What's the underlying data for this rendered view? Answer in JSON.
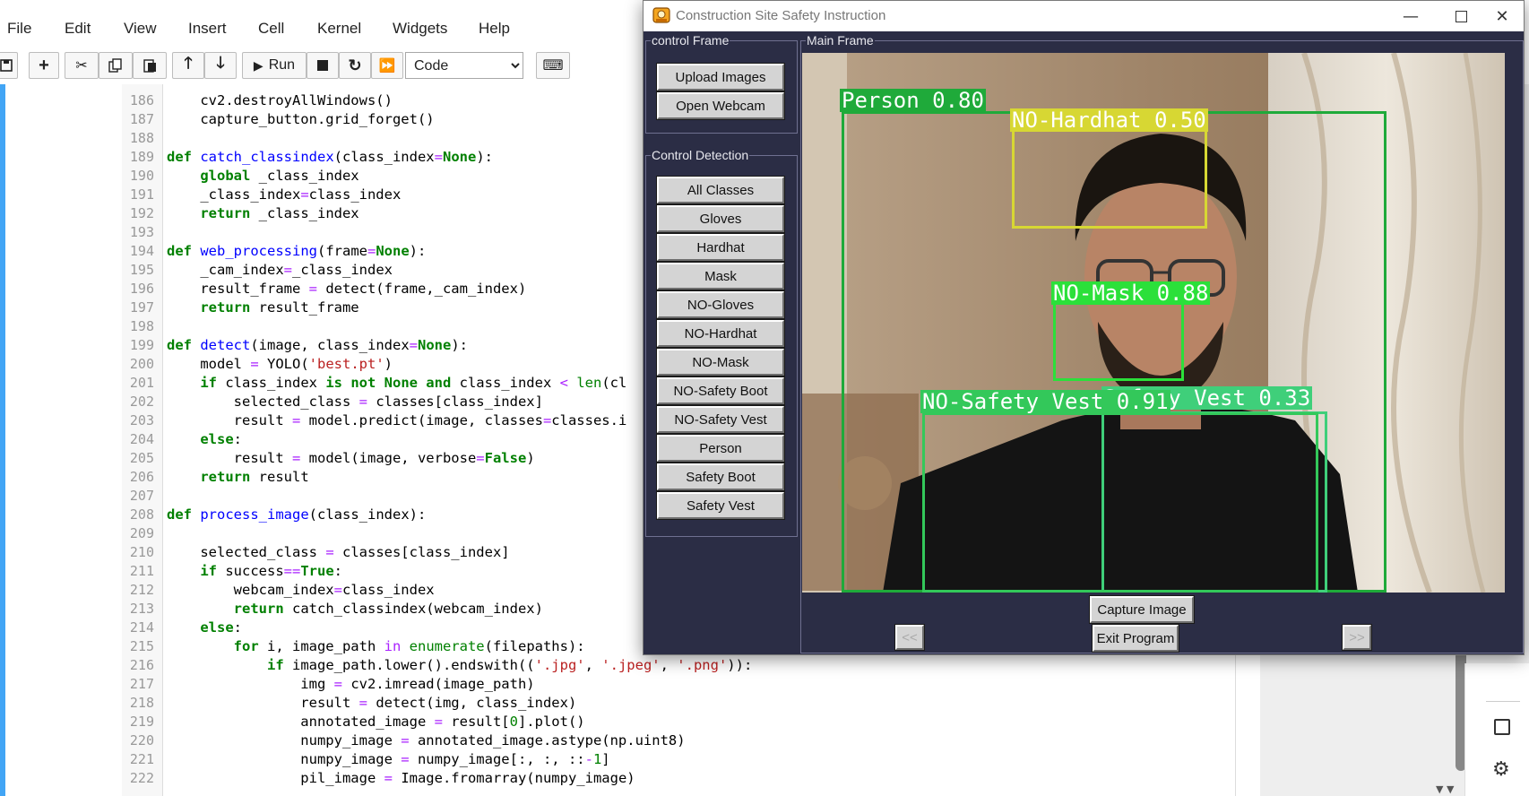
{
  "jupyter": {
    "menu": [
      "File",
      "Edit",
      "View",
      "Insert",
      "Cell",
      "Kernel",
      "Widgets",
      "Help"
    ],
    "toolbar": {
      "run_label": "Run",
      "cell_type": "Code",
      "cell_type_options": [
        "Code"
      ]
    },
    "code_lines": [
      {
        "n": "186",
        "html": "    cv2.destroyAllWindows()"
      },
      {
        "n": "187",
        "html": "    capture_button.grid_forget()"
      },
      {
        "n": "188",
        "html": ""
      },
      {
        "n": "189",
        "html": "<span class='kw'>def</span> <span class='fn'>catch_classindex</span>(class_index<span class='op'>=</span><span class='kw'>None</span>):"
      },
      {
        "n": "190",
        "html": "    <span class='kw'>global</span> _class_index"
      },
      {
        "n": "191",
        "html": "    _class_index<span class='op'>=</span>class_index"
      },
      {
        "n": "192",
        "html": "    <span class='kw'>return</span> _class_index"
      },
      {
        "n": "193",
        "html": ""
      },
      {
        "n": "194",
        "html": "<span class='kw'>def</span> <span class='fn'>web_processing</span>(frame<span class='op'>=</span><span class='kw'>None</span>):"
      },
      {
        "n": "195",
        "html": "    _cam_index<span class='op'>=</span>_class_index"
      },
      {
        "n": "196",
        "html": "    result_frame <span class='op'>=</span> detect(frame,_cam_index)"
      },
      {
        "n": "197",
        "html": "    <span class='kw'>return</span> result_frame"
      },
      {
        "n": "198",
        "html": ""
      },
      {
        "n": "199",
        "html": "<span class='kw'>def</span> <span class='fn'>detect</span>(image, class_index<span class='op'>=</span><span class='kw'>None</span>):"
      },
      {
        "n": "200",
        "html": "    model <span class='op'>=</span> YOLO(<span class='st'>'best.pt'</span>)"
      },
      {
        "n": "201",
        "html": "    <span class='kw'>if</span> class_index <span class='kw'>is not None and</span> class_index <span class='op'>&lt;</span> <span class='nb'>len</span>(cl"
      },
      {
        "n": "202",
        "html": "        selected_class <span class='op'>=</span> classes[class_index]"
      },
      {
        "n": "203",
        "html": "        result <span class='op'>=</span> model.predict(image, classes<span class='op'>=</span>classes.i"
      },
      {
        "n": "204",
        "html": "    <span class='kw'>else</span>:"
      },
      {
        "n": "205",
        "html": "        result <span class='op'>=</span> model(image, verbose<span class='op'>=</span><span class='kw'>False</span>)"
      },
      {
        "n": "206",
        "html": "    <span class='kw'>return</span> result"
      },
      {
        "n": "207",
        "html": ""
      },
      {
        "n": "208",
        "html": "<span class='kw'>def</span> <span class='fn'>process_image</span>(class_index):"
      },
      {
        "n": "209",
        "html": ""
      },
      {
        "n": "210",
        "html": "    selected_class <span class='op'>=</span> classes[class_index]"
      },
      {
        "n": "211",
        "html": "    <span class='kw'>if</span> success<span class='op'>==</span><span class='kw'>True</span>:"
      },
      {
        "n": "212",
        "html": "        webcam_index<span class='op'>=</span>class_index"
      },
      {
        "n": "213",
        "html": "        <span class='kw'>return</span> catch_classindex(webcam_index)"
      },
      {
        "n": "214",
        "html": "    <span class='kw'>else</span>:"
      },
      {
        "n": "215",
        "html": "        <span class='kw'>for</span> i, image_path <span class='op'>in</span> <span class='nb'>enumerate</span>(filepaths):"
      },
      {
        "n": "216",
        "html": "            <span class='kw'>if</span> image_path.lower().endswith((<span class='st'>'.jpg'</span>, <span class='st'>'.jpeg'</span>, <span class='st'>'.png'</span>)):"
      },
      {
        "n": "217",
        "html": "                img <span class='op'>=</span> cv2.imread(image_path)"
      },
      {
        "n": "218",
        "html": "                result <span class='op'>=</span> detect(img, class_index)"
      },
      {
        "n": "219",
        "html": "                annotated_image <span class='op'>=</span> result[<span class='nm'>0</span>].plot()"
      },
      {
        "n": "220",
        "html": "                numpy_image <span class='op'>=</span> annotated_image.astype(np.uint8)"
      },
      {
        "n": "221",
        "html": "                numpy_image <span class='op'>=</span> numpy_image[:, :, ::<span class='op'>-</span><span class='nm'>1</span>]"
      },
      {
        "n": "222",
        "html": "                pil_image <span class='op'>=</span> Image.fromarray(numpy_image)"
      }
    ]
  },
  "app": {
    "title": "Construction Site Safety Instruction",
    "control_frame_label": "control Frame",
    "upload_images": "Upload Images",
    "open_webcam": "Open Webcam",
    "control_detection_label": "Control Detection",
    "class_buttons": [
      "All Classes",
      "Gloves",
      "Hardhat",
      "Mask",
      "NO-Gloves",
      "NO-Hardhat",
      "NO-Mask",
      "NO-Safety Boot",
      "NO-Safety Vest",
      "Person",
      "Safety Boot",
      "Safety Vest"
    ],
    "main_frame_label": "Main Frame",
    "capture_image": "Capture Image",
    "exit_program": "Exit Program",
    "prev": "<<",
    "next": ">>",
    "detections": [
      {
        "label": "Person 0.80",
        "color": "#1faa3a"
      },
      {
        "label": "NO-Hardhat 0.50",
        "color": "#d7d733"
      },
      {
        "label": "NO-Mask 0.88",
        "color": "#2be03a"
      },
      {
        "label": "NO-Safety Vest 0.91",
        "color": "#33c85a"
      },
      {
        "label": "Safety Vest 0.33",
        "color": "#3fcf7a"
      }
    ]
  }
}
